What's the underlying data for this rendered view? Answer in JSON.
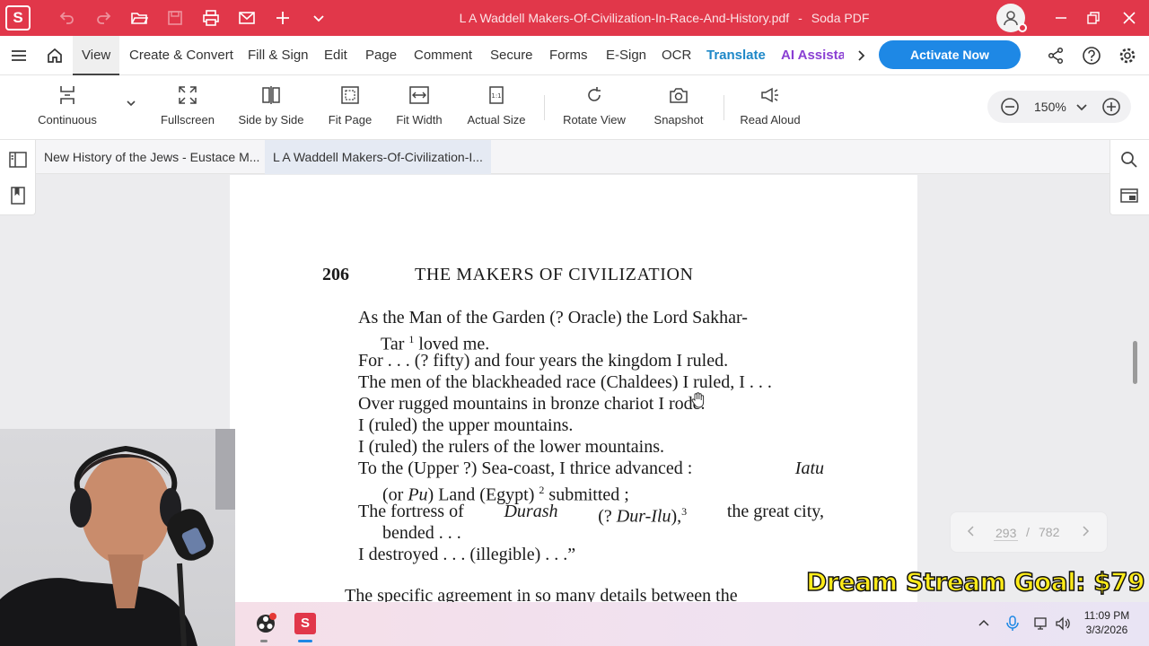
{
  "app": {
    "logo_letter": "S",
    "window_title_file": "L A Waddell Makers-Of-Civilization-In-Race-And-History.pdf",
    "window_title_sep": "-",
    "window_title_app": "Soda PDF",
    "accent_color": "#e1374a"
  },
  "menu": {
    "items": [
      "View",
      "Create & Convert",
      "Fill & Sign",
      "Edit",
      "Page",
      "Comment",
      "Secure",
      "Forms",
      "E-Sign",
      "OCR",
      "Translate",
      "AI Assista"
    ],
    "active": "View",
    "activate_label": "Activate Now"
  },
  "toolbar": {
    "continuous": "Continuous",
    "fullscreen": "Fullscreen",
    "side_by_side": "Side by Side",
    "fit_page": "Fit Page",
    "fit_width": "Fit Width",
    "actual_size": "Actual Size",
    "rotate_view": "Rotate View",
    "snapshot": "Snapshot",
    "read_aloud": "Read Aloud",
    "zoom_value": "150%"
  },
  "tabs": {
    "tab1": "New History of the Jews - Eustace M...",
    "tab2": "L A Waddell Makers-Of-Civilization-I..."
  },
  "page": {
    "page_number": "206",
    "running_head": "THE MAKERS OF CIVILIZATION",
    "lines": {
      "l1": "As the Man of the Garden (? Oracle) the Lord Sakhar-",
      "l2a": "Tar",
      "l2sup": "1",
      "l2b": "loved me.",
      "l3": "For . . . (? fifty) and four years the kingdom I ruled.",
      "l4": "The men of the blackheaded race (Chaldees) I ruled, I . . .",
      "l5": "Over rugged mountains in bronze chariot I rode.",
      "l6": "I (ruled) the upper mountains.",
      "l7": "I (ruled) the rulers of the lower mountains.",
      "l8a": "To the (Upper ?) Sea-coast, I thrice advanced :",
      "l8b": "Iatu",
      "l9a": "(or",
      "l9b": "Pu",
      "l9c": ") Land (Egypt)",
      "l9sup": "2",
      "l9d": "submitted ;",
      "l10a": "The fortress of",
      "l10b": "Durash",
      "l10c": "(?",
      "l10d": "Dur-Ilu",
      "l10e": "),",
      "l10sup": "3",
      "l10f": "the great city,",
      "l11": "bended . . .",
      "l12": "I destroyed . . . (illegible) . . .”",
      "l13": "The specific agreement in so many details between the"
    }
  },
  "pager": {
    "current": "293",
    "separator": "/",
    "total": "782"
  },
  "overlay": {
    "stream_goal": "Dream Stream Goal: $79"
  },
  "taskbar": {
    "time": "11:09 PM",
    "date": "3/3/2026"
  }
}
